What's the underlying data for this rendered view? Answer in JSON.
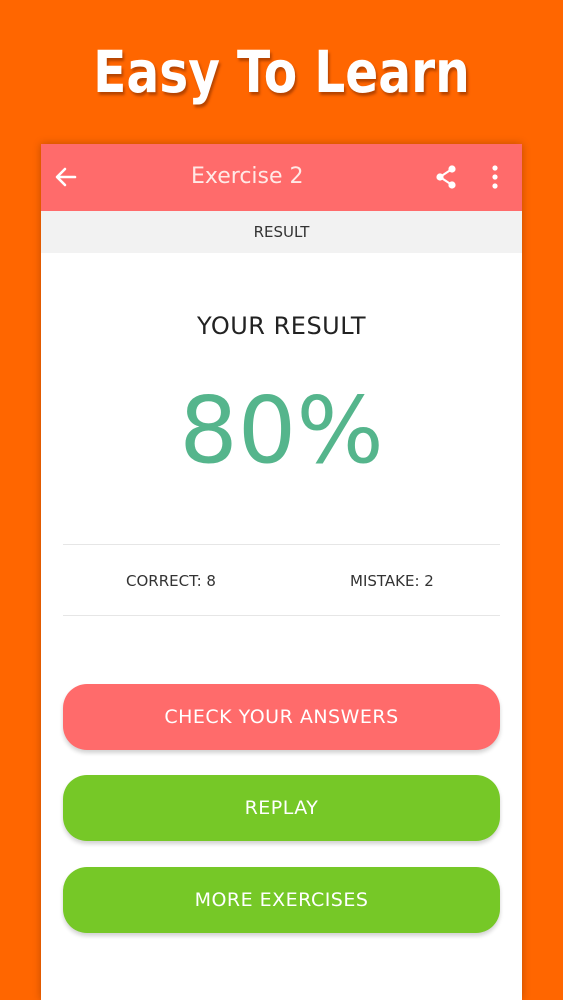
{
  "promo": {
    "title": "Easy To Learn"
  },
  "toolbar": {
    "title": "Exercise 2",
    "back_icon": "arrow-left-icon",
    "share_icon": "share-icon",
    "more_icon": "more-vertical-icon"
  },
  "tab": {
    "label": "RESULT"
  },
  "result": {
    "heading": "YOUR RESULT",
    "score": "80%",
    "correct": "CORRECT: 8",
    "mistake": "MISTAKE: 2"
  },
  "buttons": {
    "check": "CHECK YOUR ANSWERS",
    "replay": "REPLAY",
    "more": "MORE EXERCISES"
  },
  "colors": {
    "background": "#FF6600",
    "toolbar": "#FF6B6B",
    "score": "#55B58C",
    "check_button": "#FF6B6B",
    "green_button": "#76C827"
  }
}
